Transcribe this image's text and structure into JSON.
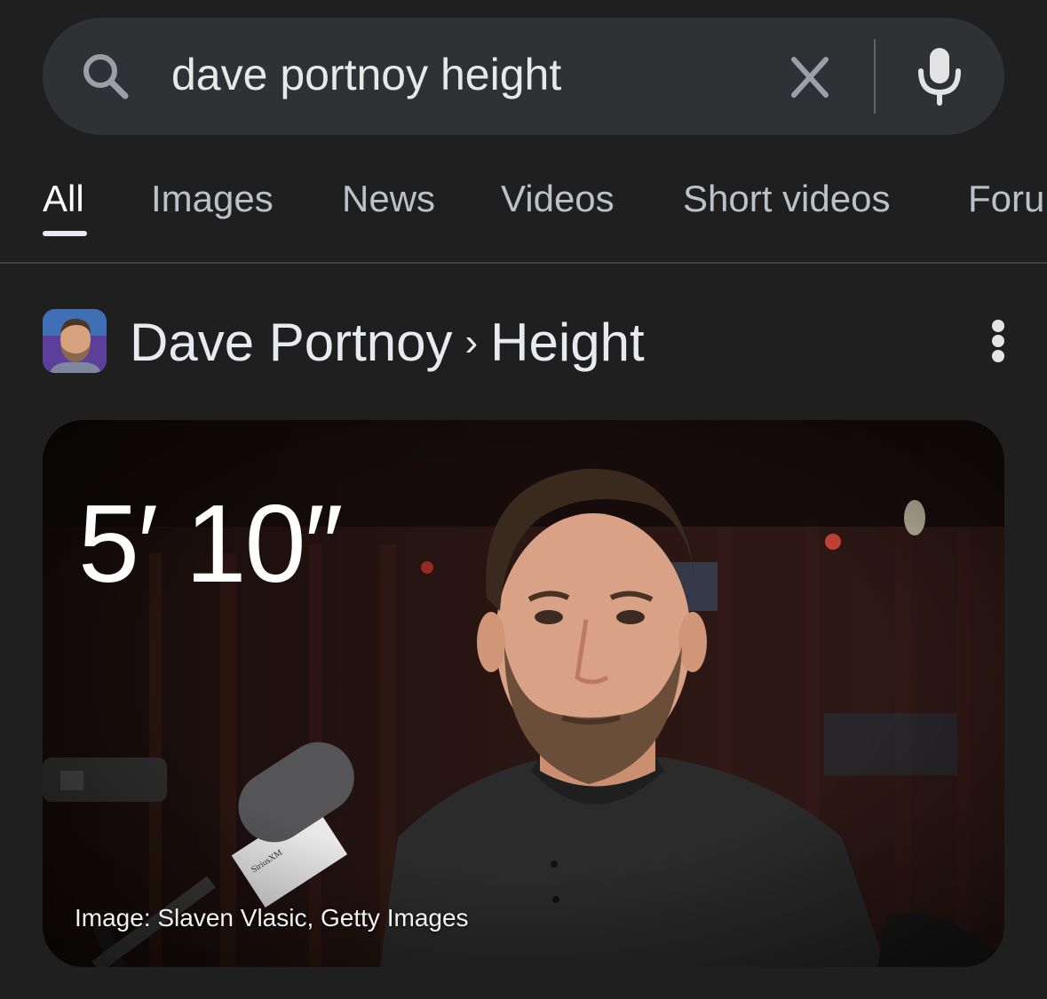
{
  "search": {
    "query": "dave portnoy height",
    "icons": {
      "search": "search-icon",
      "clear": "close-icon",
      "mic": "mic-icon"
    }
  },
  "tabs": [
    {
      "label": "All",
      "active": true
    },
    {
      "label": "Images",
      "active": false
    },
    {
      "label": "News",
      "active": false
    },
    {
      "label": "Videos",
      "active": false
    },
    {
      "label": "Short videos",
      "active": false
    },
    {
      "label": "Foru",
      "active": false
    }
  ],
  "result": {
    "entity": "Dave Portnoy",
    "separator": "›",
    "attribute": "Height",
    "height_value": "5′ 10″",
    "image_credit": "Image: Slaven Vlasic, Getty Images",
    "more_icon": "more-vert-icon"
  },
  "colors": {
    "background": "#1f1f1f",
    "searchbar": "#303134",
    "tab_inactive": "#bdc1c6",
    "tab_active": "#ffffff"
  }
}
